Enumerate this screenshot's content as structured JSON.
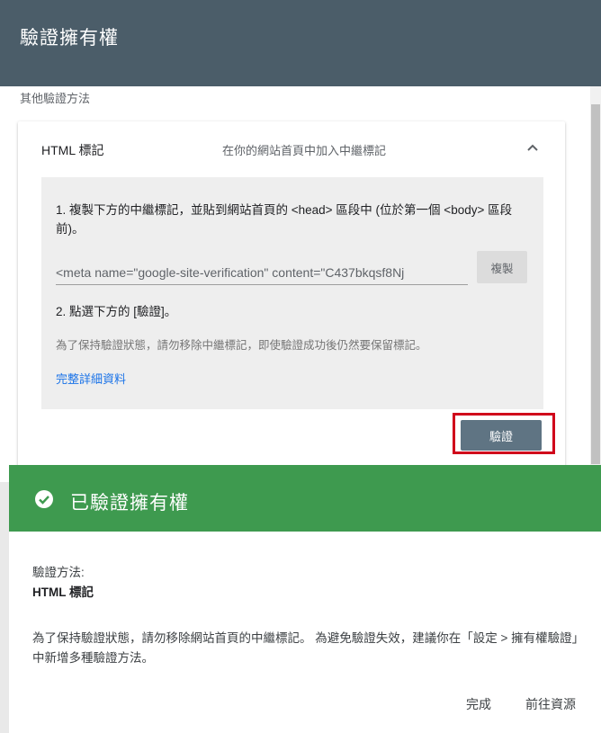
{
  "header": {
    "title": "驗證擁有權"
  },
  "section_label": "其他驗證方法",
  "card": {
    "title": "HTML 標記",
    "description": "在你的網站首頁中加入中繼標記",
    "step1": "1. 複製下方的中繼標記，並貼到網站首頁的 <head> 區段中 (位於第一個 <body> 區段前)。",
    "meta_tag": "<meta name=\"google-site-verification\" content=\"C437bkqsf8Nj",
    "copy_label": "複製",
    "step2": "2. 點選下方的 [驗證]。",
    "note": "為了保持驗證狀態，請勿移除中繼標記，即使驗證成功後仍然要保留標記。",
    "details_link": "完整詳細資料",
    "verify_label": "驗證"
  },
  "success": {
    "title": "已驗證擁有權",
    "method_label": "驗證方法:",
    "method_value": "HTML 標記",
    "message": "為了保持驗證狀態，請勿移除網站首頁的中繼標記。 為避免驗證失效，建議你在「設定 > 擁有權驗證」中新增多種驗證方法。",
    "done_label": "完成",
    "goto_label": "前往資源"
  },
  "colors": {
    "header": "#4b5d69",
    "success_bar": "#3e9a4f",
    "verify_button": "#5f7483",
    "highlight": "#d0021b",
    "link": "#1a73e8"
  },
  "icons": [
    "chevron-up-icon",
    "check-circle-icon"
  ]
}
